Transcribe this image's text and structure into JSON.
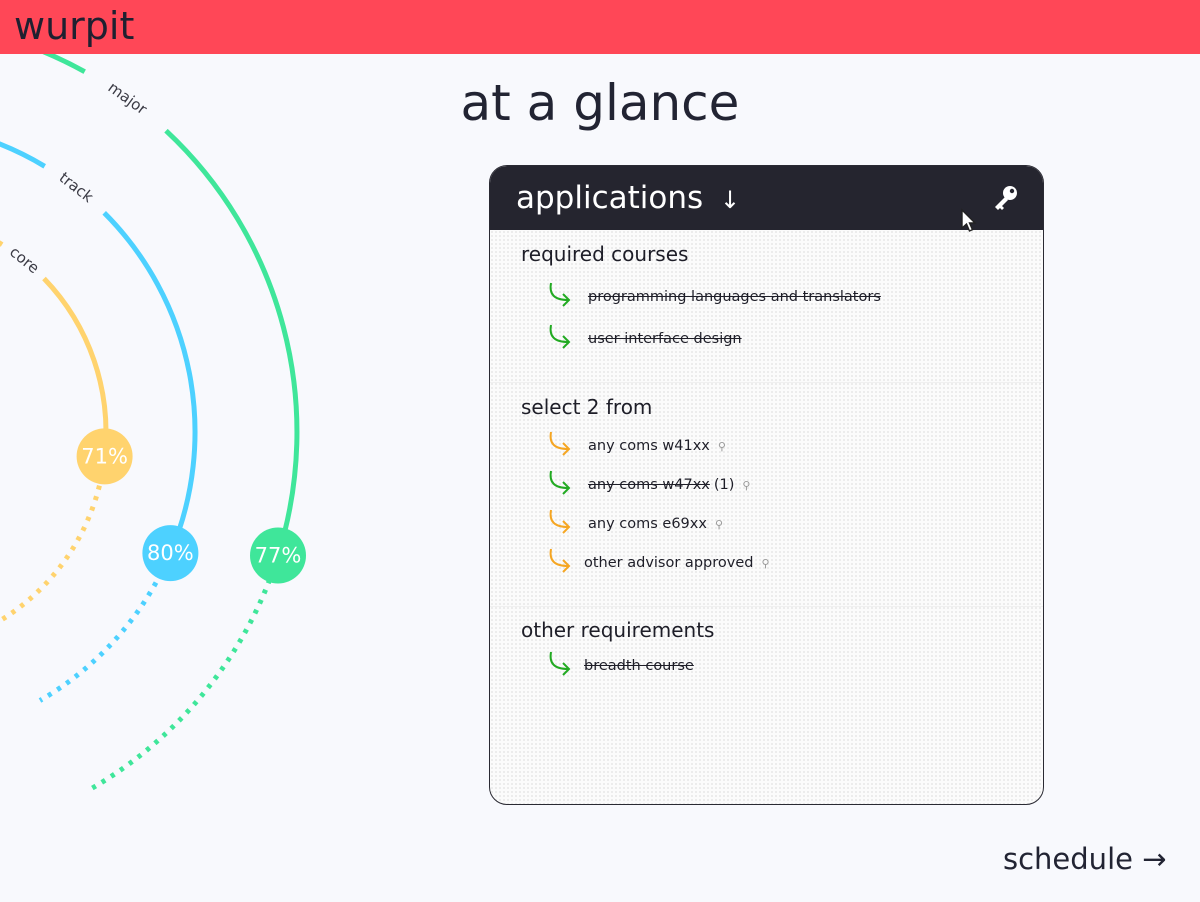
{
  "app": {
    "logo": "wurpit"
  },
  "page": {
    "title": "at a glance"
  },
  "rings": [
    {
      "label": "major",
      "percent_text": "77%",
      "fraction": 0.77,
      "color": "#3fe69a"
    },
    {
      "label": "track",
      "percent_text": "80%",
      "fraction": 0.8,
      "color": "#4dd1ff"
    },
    {
      "label": "core",
      "percent_text": "71%",
      "fraction": 0.71,
      "color": "#ffd36e"
    }
  ],
  "panel": {
    "title": "applications",
    "sort_icon": "arrow-down-icon",
    "key_icon": "key-icon",
    "sections": [
      {
        "title": "required courses",
        "items": [
          {
            "label": "programming languages and translators",
            "done": true
          },
          {
            "label": "user interface design",
            "done": true
          }
        ]
      },
      {
        "title": "select 2 from",
        "items": [
          {
            "label": "any coms w41xx",
            "done": false,
            "pinned": true
          },
          {
            "label": "any coms w47xx",
            "count": "(1)",
            "done": true,
            "pinned": true
          },
          {
            "label": "any coms e69xx",
            "done": false,
            "pinned": true
          },
          {
            "label": "other advisor approved",
            "done": false,
            "pinned": true
          }
        ]
      },
      {
        "title": "other requirements",
        "items": [
          {
            "label": "breadth course",
            "done": true
          }
        ]
      }
    ],
    "colors": {
      "done": "#22aa22",
      "pending": "#f5a623"
    }
  },
  "footer": {
    "schedule_label": "schedule →"
  }
}
